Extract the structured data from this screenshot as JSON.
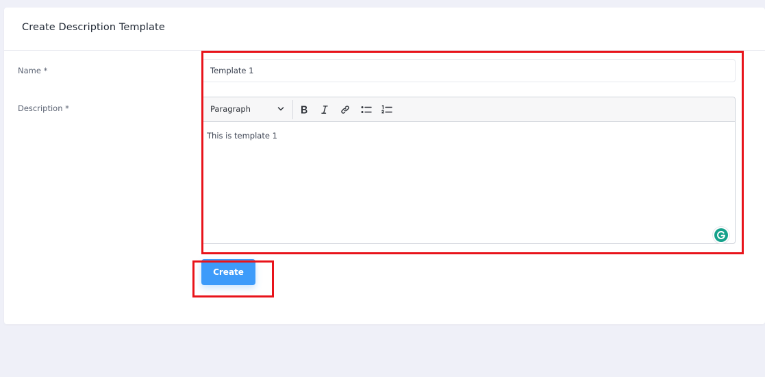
{
  "header": {
    "title": "Create Description Template"
  },
  "form": {
    "name_label": "Name *",
    "name_value": "Template 1",
    "description_label": "Description *",
    "editor": {
      "block_style": "Paragraph",
      "toolbar_icons": [
        "bold-icon",
        "italic-icon",
        "link-icon",
        "bulleted-list-icon",
        "numbered-list-icon"
      ],
      "content": "This is template 1"
    },
    "submit_label": "Create"
  },
  "colors": {
    "primary_button": "#3d9bfa",
    "highlight_box": "#e8131a",
    "grammarly": "#15a18b",
    "page_background": "#eff0f8"
  }
}
